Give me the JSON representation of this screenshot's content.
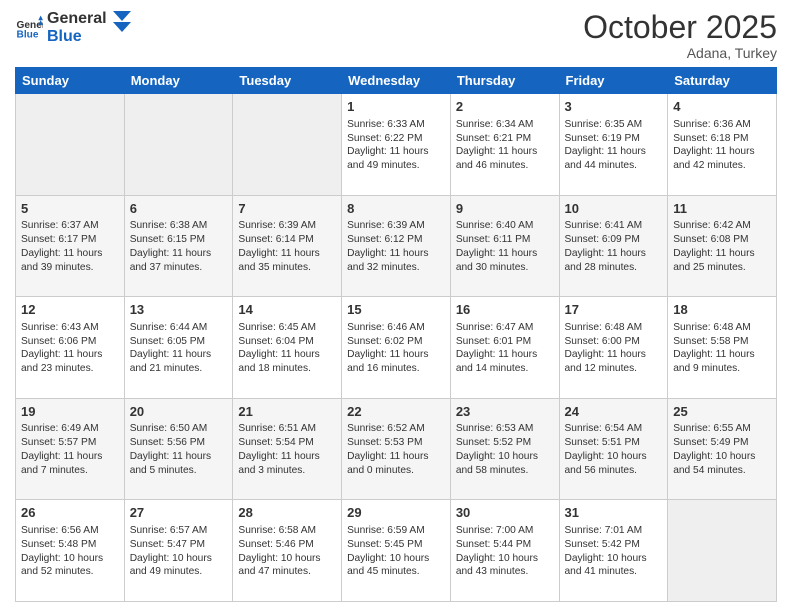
{
  "header": {
    "logo_general": "General",
    "logo_blue": "Blue",
    "month": "October 2025",
    "location": "Adana, Turkey"
  },
  "days_of_week": [
    "Sunday",
    "Monday",
    "Tuesday",
    "Wednesday",
    "Thursday",
    "Friday",
    "Saturday"
  ],
  "weeks": [
    [
      {
        "day": "",
        "info": ""
      },
      {
        "day": "",
        "info": ""
      },
      {
        "day": "",
        "info": ""
      },
      {
        "day": "1",
        "info": "Sunrise: 6:33 AM\nSunset: 6:22 PM\nDaylight: 11 hours\nand 49 minutes."
      },
      {
        "day": "2",
        "info": "Sunrise: 6:34 AM\nSunset: 6:21 PM\nDaylight: 11 hours\nand 46 minutes."
      },
      {
        "day": "3",
        "info": "Sunrise: 6:35 AM\nSunset: 6:19 PM\nDaylight: 11 hours\nand 44 minutes."
      },
      {
        "day": "4",
        "info": "Sunrise: 6:36 AM\nSunset: 6:18 PM\nDaylight: 11 hours\nand 42 minutes."
      }
    ],
    [
      {
        "day": "5",
        "info": "Sunrise: 6:37 AM\nSunset: 6:17 PM\nDaylight: 11 hours\nand 39 minutes."
      },
      {
        "day": "6",
        "info": "Sunrise: 6:38 AM\nSunset: 6:15 PM\nDaylight: 11 hours\nand 37 minutes."
      },
      {
        "day": "7",
        "info": "Sunrise: 6:39 AM\nSunset: 6:14 PM\nDaylight: 11 hours\nand 35 minutes."
      },
      {
        "day": "8",
        "info": "Sunrise: 6:39 AM\nSunset: 6:12 PM\nDaylight: 11 hours\nand 32 minutes."
      },
      {
        "day": "9",
        "info": "Sunrise: 6:40 AM\nSunset: 6:11 PM\nDaylight: 11 hours\nand 30 minutes."
      },
      {
        "day": "10",
        "info": "Sunrise: 6:41 AM\nSunset: 6:09 PM\nDaylight: 11 hours\nand 28 minutes."
      },
      {
        "day": "11",
        "info": "Sunrise: 6:42 AM\nSunset: 6:08 PM\nDaylight: 11 hours\nand 25 minutes."
      }
    ],
    [
      {
        "day": "12",
        "info": "Sunrise: 6:43 AM\nSunset: 6:06 PM\nDaylight: 11 hours\nand 23 minutes."
      },
      {
        "day": "13",
        "info": "Sunrise: 6:44 AM\nSunset: 6:05 PM\nDaylight: 11 hours\nand 21 minutes."
      },
      {
        "day": "14",
        "info": "Sunrise: 6:45 AM\nSunset: 6:04 PM\nDaylight: 11 hours\nand 18 minutes."
      },
      {
        "day": "15",
        "info": "Sunrise: 6:46 AM\nSunset: 6:02 PM\nDaylight: 11 hours\nand 16 minutes."
      },
      {
        "day": "16",
        "info": "Sunrise: 6:47 AM\nSunset: 6:01 PM\nDaylight: 11 hours\nand 14 minutes."
      },
      {
        "day": "17",
        "info": "Sunrise: 6:48 AM\nSunset: 6:00 PM\nDaylight: 11 hours\nand 12 minutes."
      },
      {
        "day": "18",
        "info": "Sunrise: 6:48 AM\nSunset: 5:58 PM\nDaylight: 11 hours\nand 9 minutes."
      }
    ],
    [
      {
        "day": "19",
        "info": "Sunrise: 6:49 AM\nSunset: 5:57 PM\nDaylight: 11 hours\nand 7 minutes."
      },
      {
        "day": "20",
        "info": "Sunrise: 6:50 AM\nSunset: 5:56 PM\nDaylight: 11 hours\nand 5 minutes."
      },
      {
        "day": "21",
        "info": "Sunrise: 6:51 AM\nSunset: 5:54 PM\nDaylight: 11 hours\nand 3 minutes."
      },
      {
        "day": "22",
        "info": "Sunrise: 6:52 AM\nSunset: 5:53 PM\nDaylight: 11 hours\nand 0 minutes."
      },
      {
        "day": "23",
        "info": "Sunrise: 6:53 AM\nSunset: 5:52 PM\nDaylight: 10 hours\nand 58 minutes."
      },
      {
        "day": "24",
        "info": "Sunrise: 6:54 AM\nSunset: 5:51 PM\nDaylight: 10 hours\nand 56 minutes."
      },
      {
        "day": "25",
        "info": "Sunrise: 6:55 AM\nSunset: 5:49 PM\nDaylight: 10 hours\nand 54 minutes."
      }
    ],
    [
      {
        "day": "26",
        "info": "Sunrise: 6:56 AM\nSunset: 5:48 PM\nDaylight: 10 hours\nand 52 minutes."
      },
      {
        "day": "27",
        "info": "Sunrise: 6:57 AM\nSunset: 5:47 PM\nDaylight: 10 hours\nand 49 minutes."
      },
      {
        "day": "28",
        "info": "Sunrise: 6:58 AM\nSunset: 5:46 PM\nDaylight: 10 hours\nand 47 minutes."
      },
      {
        "day": "29",
        "info": "Sunrise: 6:59 AM\nSunset: 5:45 PM\nDaylight: 10 hours\nand 45 minutes."
      },
      {
        "day": "30",
        "info": "Sunrise: 7:00 AM\nSunset: 5:44 PM\nDaylight: 10 hours\nand 43 minutes."
      },
      {
        "day": "31",
        "info": "Sunrise: 7:01 AM\nSunset: 5:42 PM\nDaylight: 10 hours\nand 41 minutes."
      },
      {
        "day": "",
        "info": ""
      }
    ]
  ]
}
